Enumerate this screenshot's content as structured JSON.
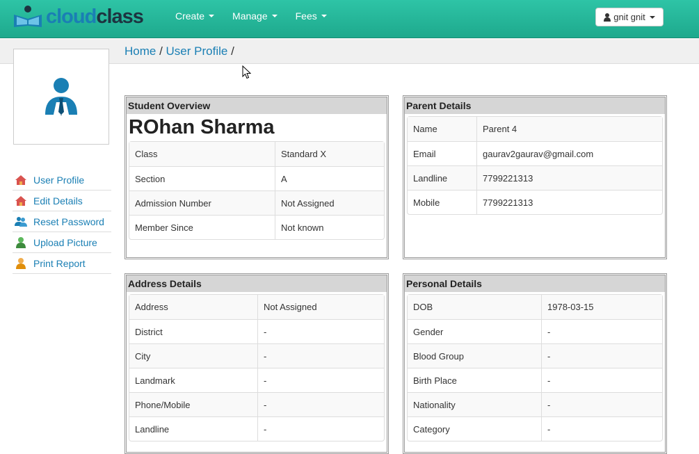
{
  "brand": {
    "part1": "cloud",
    "part2": "class",
    "color_primary": "#1a7fb4",
    "color_dark": "#1d3340"
  },
  "nav": {
    "items": [
      {
        "label": "Create"
      },
      {
        "label": "Manage"
      },
      {
        "label": "Fees"
      }
    ]
  },
  "user_menu": {
    "label": "gnit gnit",
    "icon": "user-icon"
  },
  "breadcrumb": {
    "home": "Home",
    "sep1": " / ",
    "current": "User Profile",
    "sep2": " /"
  },
  "sidebar": {
    "items": [
      {
        "label": "User Profile",
        "icon": "home-icon"
      },
      {
        "label": "Edit Details",
        "icon": "home-icon"
      },
      {
        "label": "Reset Password",
        "icon": "users-icon"
      },
      {
        "label": "Upload Picture",
        "icon": "user-green-icon"
      },
      {
        "label": "Print Report",
        "icon": "user-orange-icon"
      }
    ]
  },
  "student_overview": {
    "title": "Student Overview",
    "name": "ROhan Sharma",
    "rows": [
      {
        "label": "Class",
        "value": "Standard X"
      },
      {
        "label": "Section",
        "value": "A"
      },
      {
        "label": "Admission Number",
        "value": "Not Assigned"
      },
      {
        "label": "Member Since",
        "value": "Not known"
      }
    ]
  },
  "parent_details": {
    "title": "Parent Details",
    "rows": [
      {
        "label": "Name",
        "value": "Parent 4"
      },
      {
        "label": "Email",
        "value": "gaurav2gaurav@gmail.com"
      },
      {
        "label": "Landline",
        "value": "7799221313"
      },
      {
        "label": "Mobile",
        "value": "7799221313"
      }
    ]
  },
  "address_details": {
    "title": "Address Details",
    "rows": [
      {
        "label": "Address",
        "value": "Not Assigned"
      },
      {
        "label": "District",
        "value": "-"
      },
      {
        "label": "City",
        "value": "-"
      },
      {
        "label": "Landmark",
        "value": "-"
      },
      {
        "label": "Phone/Mobile",
        "value": "-"
      },
      {
        "label": "Landline",
        "value": "-"
      }
    ]
  },
  "personal_details": {
    "title": "Personal Details",
    "rows": [
      {
        "label": "DOB",
        "value": "1978-03-15"
      },
      {
        "label": "Gender",
        "value": "-"
      },
      {
        "label": "Blood Group",
        "value": "-"
      },
      {
        "label": "Birth Place",
        "value": "-"
      },
      {
        "label": "Nationality",
        "value": "-"
      },
      {
        "label": "Category",
        "value": "-"
      }
    ]
  }
}
